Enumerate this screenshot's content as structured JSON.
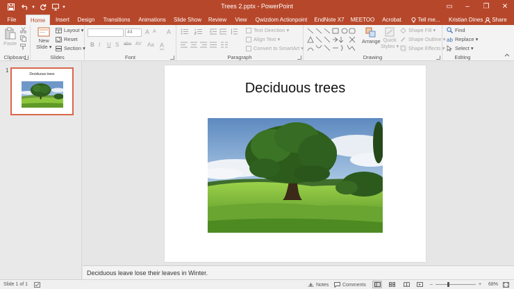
{
  "window": {
    "title": "Trees 2.pptx - PowerPoint",
    "controls": {
      "minimize": "–",
      "restore": "❐",
      "close": "✕",
      "ribbon_display": "▭"
    }
  },
  "qat": {
    "save": "💾",
    "undo": "↶",
    "undo_dropdown": "▾",
    "redo": "↻",
    "present": "▣",
    "customize": "▾"
  },
  "tabs": [
    {
      "label": "File"
    },
    {
      "label": "Home"
    },
    {
      "label": "Insert"
    },
    {
      "label": "Design"
    },
    {
      "label": "Transitions"
    },
    {
      "label": "Animations"
    },
    {
      "label": "Slide Show"
    },
    {
      "label": "Review"
    },
    {
      "label": "View"
    },
    {
      "label": "Qwizdom Actionpoint"
    },
    {
      "label": "EndNote X7"
    },
    {
      "label": "MEETOO"
    },
    {
      "label": "Acrobat"
    },
    {
      "label": "Tell me..."
    },
    {
      "label": "Kristian Dines"
    },
    {
      "label": "Share"
    }
  ],
  "ribbon": {
    "clipboard": {
      "label": "Clipboard",
      "paste": "Paste"
    },
    "slides": {
      "label": "Slides",
      "new_slide_1": "New",
      "new_slide_2": "Slide ▾",
      "layout": "Layout ▾",
      "reset": "Reset",
      "section": "Section ▾"
    },
    "font": {
      "label": "Font",
      "font_size": "44",
      "bold": "B",
      "italic": "I",
      "underline": "U",
      "strike": "S",
      "shadow": "abc",
      "spacing": "AV",
      "case": "Aa",
      "color": "A",
      "grow": "A",
      "shrink": "A",
      "clear": "A"
    },
    "paragraph": {
      "label": "Paragraph",
      "text_direction": "Text Direction ▾",
      "align_text": "Align Text ▾",
      "convert_smartart": "Convert to SmartArt ▾"
    },
    "drawing": {
      "label": "Drawing",
      "arrange": "Arrange",
      "quick_styles_1": "Quick",
      "quick_styles_2": "Styles ▾",
      "shape_fill": "Shape Fill ▾",
      "shape_outline": "Shape Outline ▾",
      "shape_effects": "Shape Effects ▾"
    },
    "editing": {
      "label": "Editing",
      "find": "Find",
      "replace": "Replace ▾",
      "select": "Select ▾"
    }
  },
  "thumbnails": [
    {
      "number": "1",
      "title": "Deciduous trees"
    }
  ],
  "slide": {
    "title": "Deciduous trees"
  },
  "notes": {
    "text": "Deciduous leave lose their leaves in Winter."
  },
  "status": {
    "slide_info": "Slide 1 of 1",
    "notes": "Notes",
    "comments": "Comments",
    "zoom": "68%",
    "zoom_level": 0.68
  },
  "colors": {
    "accent": "#b7472a",
    "thumb_border": "#d9664a"
  }
}
